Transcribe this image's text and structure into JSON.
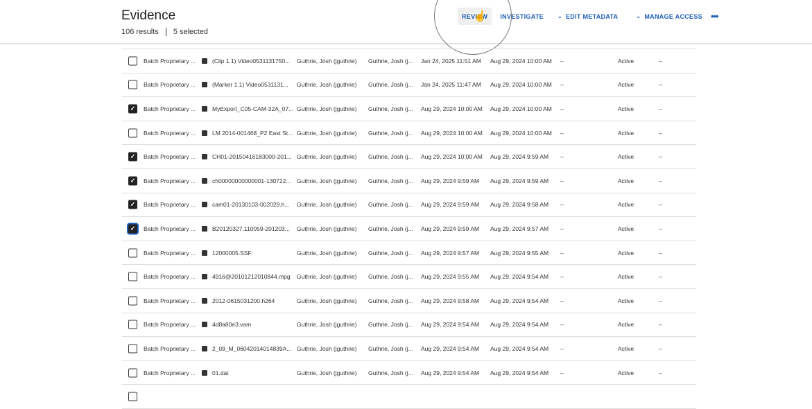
{
  "header": {
    "title": "Evidence",
    "results": "106 results",
    "selected": "5 selected"
  },
  "actions": {
    "review": "REVIEW",
    "investigate": "INVESTIGATE",
    "edit_metadata": "EDIT METADATA",
    "manage_access": "MANAGE ACCESS",
    "more": "•••"
  },
  "colors": {
    "accent": "#1d5fb8"
  },
  "rows": [
    {
      "checked": false,
      "source": "Batch Proprietary ...",
      "icon": "video-icon",
      "name": "(Clip 1.1) Video0531131750...",
      "owner": "Guthrie, Josh (jguthrie)",
      "uploader": "Guthrie, Josh (j...",
      "date1": "Jan 24, 2025 11:51 AM",
      "date2": "Aug 29, 2024 10:00 AM",
      "c1": "–",
      "status": "Active",
      "c2": "–"
    },
    {
      "checked": false,
      "source": "Batch Proprietary ...",
      "icon": "image-icon",
      "name": "(Marker 1.1) Video0531131...",
      "owner": "Guthrie, Josh (jguthrie)",
      "uploader": "Guthrie, Josh (j...",
      "date1": "Jan 24, 2025 11:47 AM",
      "date2": "Aug 29, 2024 10:00 AM",
      "c1": "–",
      "status": "Active",
      "c2": "–"
    },
    {
      "checked": true,
      "source": "Batch Proprietary ...",
      "icon": "video-icon",
      "name": "MyExport_C05-CAM-32A_07...",
      "owner": "Guthrie, Josh (jguthrie)",
      "uploader": "Guthrie, Josh (j...",
      "date1": "Aug 29, 2024 10:00 AM",
      "date2": "Aug 29, 2024 10:00 AM",
      "c1": "–",
      "status": "Active",
      "c2": "–"
    },
    {
      "checked": false,
      "source": "Batch Proprietary ...",
      "icon": "video-icon",
      "name": "LM 2014-001468_P2 East St...",
      "owner": "Guthrie, Josh (jguthrie)",
      "uploader": "Guthrie, Josh (j...",
      "date1": "Aug 29, 2024 10:00 AM",
      "date2": "Aug 29, 2024 10:00 AM",
      "c1": "–",
      "status": "Active",
      "c2": "–"
    },
    {
      "checked": true,
      "source": "Batch Proprietary ...",
      "icon": "video-icon",
      "name": "CH01-20150416183000-201...",
      "owner": "Guthrie, Josh (jguthrie)",
      "uploader": "Guthrie, Josh (j...",
      "date1": "Aug 29, 2024 10:00 AM",
      "date2": "Aug 29, 2024 9:59 AM",
      "c1": "–",
      "status": "Active",
      "c2": "–"
    },
    {
      "checked": true,
      "source": "Batch Proprietary ...",
      "icon": "video-icon",
      "name": "ch00000000000001-130722...",
      "owner": "Guthrie, Josh (jguthrie)",
      "uploader": "Guthrie, Josh (j...",
      "date1": "Aug 29, 2024 9:59 AM",
      "date2": "Aug 29, 2024 9:59 AM",
      "c1": "–",
      "status": "Active",
      "c2": "–"
    },
    {
      "checked": true,
      "source": "Batch Proprietary ...",
      "icon": "video-icon",
      "name": "cam01-20130103-002029.h...",
      "owner": "Guthrie, Josh (jguthrie)",
      "uploader": "Guthrie, Josh (j...",
      "date1": "Aug 29, 2024 9:59 AM",
      "date2": "Aug 29, 2024 9:58 AM",
      "c1": "–",
      "status": "Active",
      "c2": "–"
    },
    {
      "checked": true,
      "focused": true,
      "source": "Batch Proprietary ...",
      "icon": "video-icon",
      "name": "B20120327.110059-201203...",
      "owner": "Guthrie, Josh (jguthrie)",
      "uploader": "Guthrie, Josh (j...",
      "date1": "Aug 29, 2024 9:59 AM",
      "date2": "Aug 29, 2024 9:57 AM",
      "c1": "–",
      "status": "Active",
      "c2": "–"
    },
    {
      "checked": false,
      "source": "Batch Proprietary ...",
      "icon": "video-icon",
      "name": "12000005.SSF",
      "owner": "Guthrie, Josh (jguthrie)",
      "uploader": "Guthrie, Josh (j...",
      "date1": "Aug 29, 2024 9:57 AM",
      "date2": "Aug 29, 2024 9:55 AM",
      "c1": "–",
      "status": "Active",
      "c2": "–"
    },
    {
      "checked": false,
      "source": "Batch Proprietary ...",
      "icon": "video-icon",
      "name": "4916@20101212010844.mpg",
      "owner": "Guthrie, Josh (jguthrie)",
      "uploader": "Guthrie, Josh (j...",
      "date1": "Aug 29, 2024 9:55 AM",
      "date2": "Aug 29, 2024 9:54 AM",
      "c1": "–",
      "status": "Active",
      "c2": "–"
    },
    {
      "checked": false,
      "source": "Batch Proprietary ...",
      "icon": "video-icon",
      "name": "2012-0615031200.h264",
      "owner": "Guthrie, Josh (jguthrie)",
      "uploader": "Guthrie, Josh (j...",
      "date1": "Aug 29, 2024 9:58 AM",
      "date2": "Aug 29, 2024 9:54 AM",
      "c1": "–",
      "status": "Active",
      "c2": "–"
    },
    {
      "checked": false,
      "source": "Batch Proprietary ...",
      "icon": "video-icon",
      "name": "4d8a80e3.vam",
      "owner": "Guthrie, Josh (jguthrie)",
      "uploader": "Guthrie, Josh (j...",
      "date1": "Aug 29, 2024 9:54 AM",
      "date2": "Aug 29, 2024 9:54 AM",
      "c1": "–",
      "status": "Active",
      "c2": "–"
    },
    {
      "checked": false,
      "source": "Batch Proprietary ...",
      "icon": "video-icon",
      "name": "2_09_M_06042014014839A...",
      "owner": "Guthrie, Josh (jguthrie)",
      "uploader": "Guthrie, Josh (j...",
      "date1": "Aug 29, 2024 9:54 AM",
      "date2": "Aug 29, 2024 9:54 AM",
      "c1": "–",
      "status": "Active",
      "c2": "–"
    },
    {
      "checked": false,
      "source": "Batch Proprietary ...",
      "icon": "video-icon",
      "name": "01.dat",
      "owner": "Guthrie, Josh (jguthrie)",
      "uploader": "Guthrie, Josh (j...",
      "date1": "Aug 29, 2024 9:54 AM",
      "date2": "Aug 29, 2024 9:54 AM",
      "c1": "–",
      "status": "Active",
      "c2": "–"
    }
  ]
}
